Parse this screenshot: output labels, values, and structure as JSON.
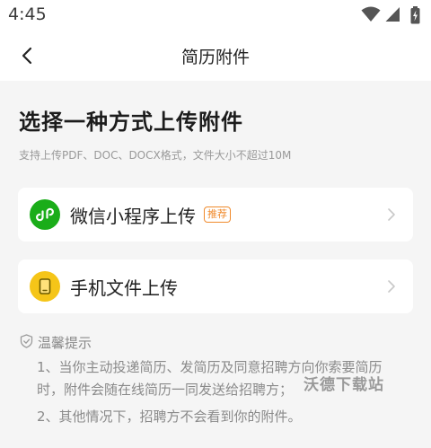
{
  "status_bar": {
    "time": "4:45",
    "icons": [
      "wifi-icon",
      "signal-icon",
      "battery-charging-icon"
    ]
  },
  "header": {
    "title": "简历附件",
    "back_icon": "chevron-left-icon"
  },
  "main": {
    "heading": "选择一种方式上传附件",
    "subtitle": "支持上传PDF、DOC、DOCX格式，文件大小不超过10M",
    "options": [
      {
        "label": "微信小程序上传",
        "badge": "推荐",
        "icon": "wechat-miniprogram-icon",
        "icon_color": "#1aad19"
      },
      {
        "label": "手机文件上传",
        "icon": "phone-file-icon",
        "icon_color": "#f5c518"
      }
    ],
    "tips": {
      "title": "温馨提示",
      "items": [
        "1、当你主动投递简历、发简历及同意招聘方向你索要简历时，附件会随在线简历一同发送给招聘方；",
        "2、其他情况下，招聘方不会看到你的附件。"
      ]
    }
  },
  "watermark": "沃德下载站",
  "colors": {
    "background": "#f5f5f5",
    "badge": "#f08a2c",
    "wechat_green": "#1aad19",
    "file_yellow": "#f5c518"
  }
}
